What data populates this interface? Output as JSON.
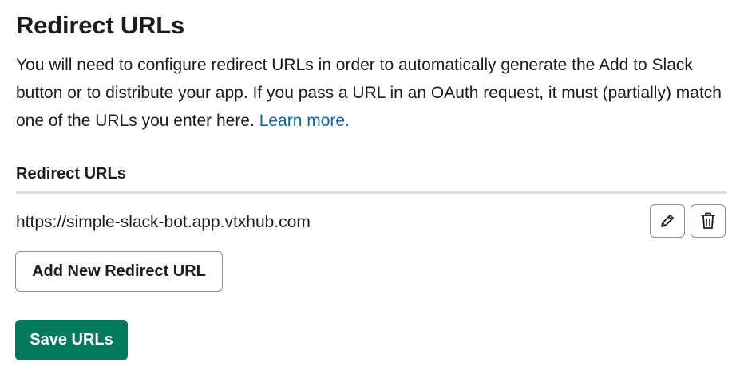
{
  "section": {
    "title": "Redirect URLs",
    "description_text": "You will need to configure redirect URLs in order to automatically generate the Add to Slack button or to distribute your app. If you pass a URL in an OAuth request, it must (partially) match one of the URLs you enter here.",
    "learn_more_label": "Learn more."
  },
  "redirects": {
    "label": "Redirect URLs",
    "urls": [
      {
        "url": "https://simple-slack-bot.app.vtxhub.com",
        "edit_icon": "pencil-icon",
        "delete_icon": "trash-icon"
      }
    ]
  },
  "buttons": {
    "add_label": "Add New Redirect URL",
    "save_label": "Save URLs"
  },
  "colors": {
    "link": "#1264a3",
    "save_button": "#007a5a",
    "text": "#1d1c1d",
    "divider": "#dddddd"
  }
}
